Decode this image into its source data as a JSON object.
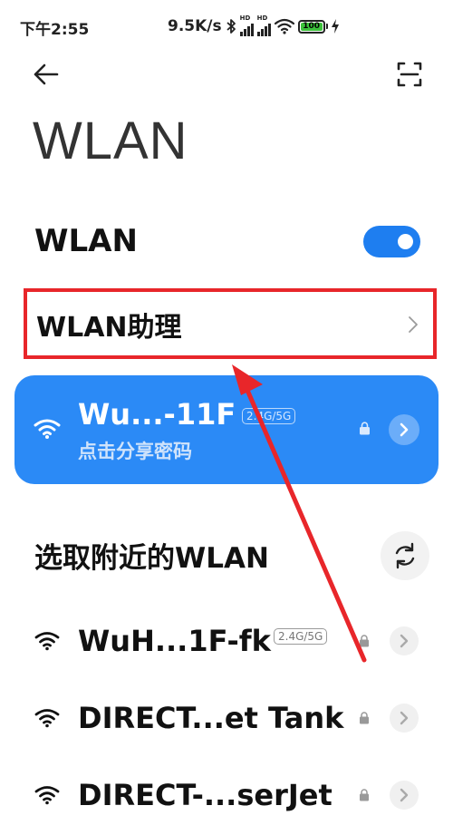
{
  "status_bar": {
    "time": "下午2:55",
    "net_speed": "9.5K/s",
    "signal_badge": "HD",
    "battery": "100"
  },
  "icons": {
    "back": "back-arrow-icon",
    "scan": "scan-icon",
    "wifi": "wifi-icon",
    "lock": "lock-icon",
    "chevron": "chevron-right-icon",
    "refresh": "refresh-icon"
  },
  "page": {
    "title": "WLAN"
  },
  "wlan_switch": {
    "label": "WLAN",
    "enabled": true
  },
  "assistant": {
    "label": "WLAN助理"
  },
  "connected": {
    "name": "Wu...-11F",
    "band": "2.4G/5G",
    "subtitle": "点击分享密码"
  },
  "nearby": {
    "title": "选取附近的WLAN",
    "networks": [
      {
        "name": "WuH...1F-fk",
        "band": "2.4G/5G",
        "locked": true
      },
      {
        "name": "DIRECT...et Tank",
        "band": "",
        "locked": true
      },
      {
        "name": "DIRECT-...serJet",
        "band": "",
        "locked": true
      }
    ]
  },
  "colors": {
    "accent": "#2b8af6",
    "toggle": "#1e7ef0",
    "highlight_annotation": "#e8262a",
    "battery_fill": "#3cc13b"
  }
}
